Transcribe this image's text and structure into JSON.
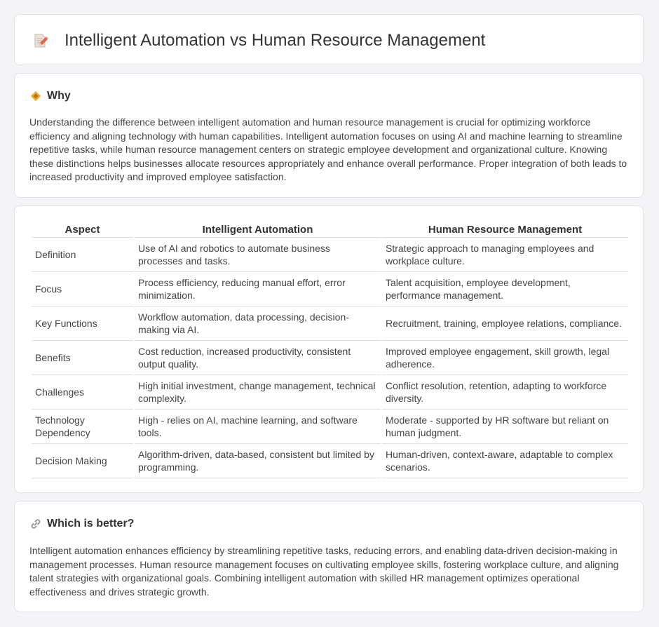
{
  "header": {
    "title": "Intelligent Automation vs Human Resource Management",
    "icon": "document-pencil-icon"
  },
  "why": {
    "title": "Why",
    "icon": "diamond-sign-icon",
    "body": "Understanding the difference between intelligent automation and human resource management is crucial for optimizing workforce efficiency and aligning technology with human capabilities. Intelligent automation focuses on using AI and machine learning to streamline repetitive tasks, while human resource management centers on strategic employee development and organizational culture. Knowing these distinctions helps businesses allocate resources appropriately and enhance overall performance. Proper integration of both leads to increased productivity and improved employee satisfaction."
  },
  "comparison": {
    "headers": [
      "Aspect",
      "Intelligent Automation",
      "Human Resource Management"
    ],
    "rows": [
      {
        "aspect": "Definition",
        "ia": "Use of AI and robotics to automate business processes and tasks.",
        "hrm": "Strategic approach to managing employees and workplace culture."
      },
      {
        "aspect": "Focus",
        "ia": "Process efficiency, reducing manual effort, error minimization.",
        "hrm": "Talent acquisition, employee development, performance management."
      },
      {
        "aspect": "Key Functions",
        "ia": "Workflow automation, data processing, decision-making via AI.",
        "hrm": "Recruitment, training, employee relations, compliance."
      },
      {
        "aspect": "Benefits",
        "ia": "Cost reduction, increased productivity, consistent output quality.",
        "hrm": "Improved employee engagement, skill growth, legal adherence."
      },
      {
        "aspect": "Challenges",
        "ia": "High initial investment, change management, technical complexity.",
        "hrm": "Conflict resolution, retention, adapting to workforce diversity."
      },
      {
        "aspect": "Technology Dependency",
        "ia": "High - relies on AI, machine learning, and software tools.",
        "hrm": "Moderate - supported by HR software but reliant on human judgment."
      },
      {
        "aspect": "Decision Making",
        "ia": "Algorithm-driven, data-based, consistent but limited by programming.",
        "hrm": "Human-driven, context-aware, adaptable to complex scenarios."
      }
    ]
  },
  "better": {
    "title": "Which is better?",
    "icon": "link-icon",
    "body": "Intelligent automation enhances efficiency by streamlining repetitive tasks, reducing errors, and enabling data-driven decision-making in management processes. Human resource management focuses on cultivating employee skills, fostering workplace culture, and aligning talent strategies with organizational goals. Combining intelligent automation with skilled HR management optimizes operational effectiveness and drives strategic growth."
  }
}
